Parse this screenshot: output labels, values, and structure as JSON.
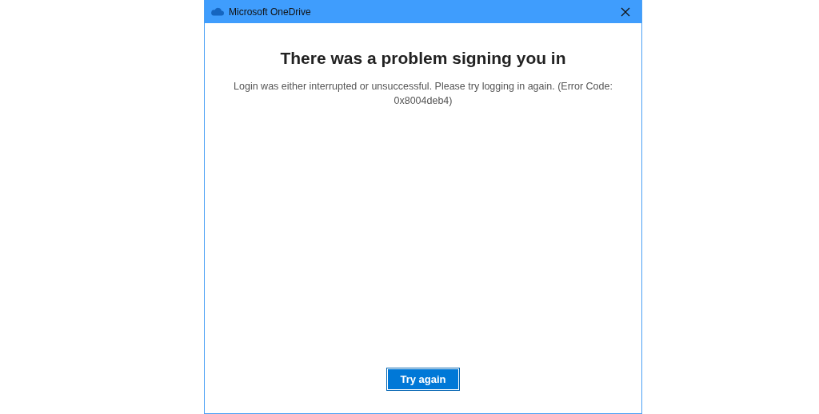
{
  "window": {
    "title": "Microsoft OneDrive"
  },
  "heading": "There was a problem signing you in",
  "message": "Login was either interrupted or unsuccessful. Please try logging in again. (Error Code: 0x8004deb4)",
  "buttons": [
    "Try again"
  ]
}
